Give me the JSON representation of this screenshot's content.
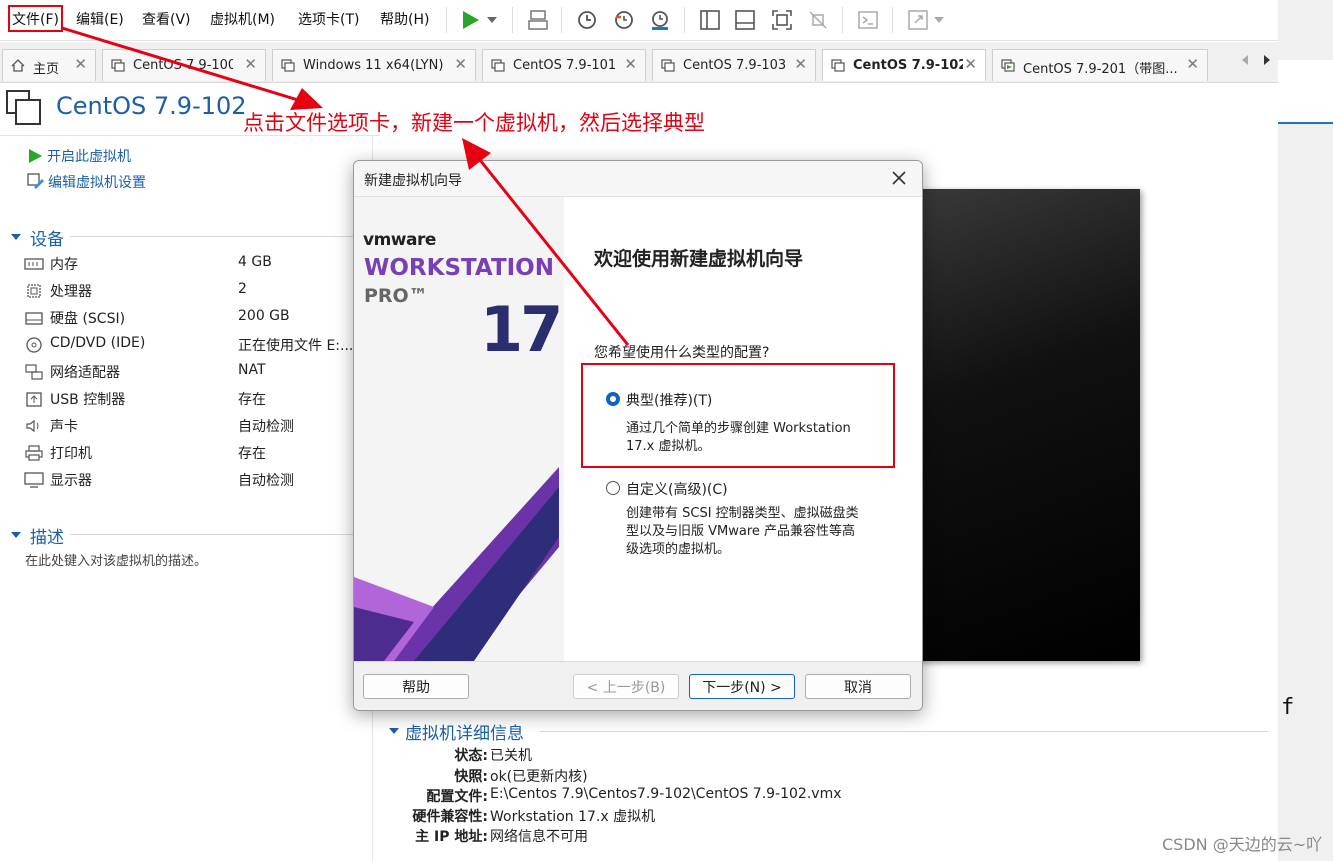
{
  "menubar": {
    "items": [
      "文件(F)",
      "编辑(E)",
      "查看(V)",
      "虚拟机(M)",
      "选项卡(T)",
      "帮助(H)"
    ]
  },
  "tabs": [
    {
      "label": "主页"
    },
    {
      "label": "CentOS 7.9-100"
    },
    {
      "label": "Windows 11 x64(LYN)"
    },
    {
      "label": "CentOS 7.9-101"
    },
    {
      "label": "CentOS 7.9-103"
    },
    {
      "label": "CentOS 7.9-102"
    },
    {
      "label": "CentOS 7.9-201（带图..."
    }
  ],
  "vm": {
    "title": "CentOS 7.9-102",
    "actions": {
      "power_on": "开启此虚拟机",
      "edit_settings": "编辑虚拟机设置"
    }
  },
  "devices": {
    "heading": "设备",
    "items": [
      {
        "name": "内存",
        "value": "4 GB",
        "icon": "memory-icon"
      },
      {
        "name": "处理器",
        "value": "2",
        "icon": "cpu-icon"
      },
      {
        "name": "硬盘 (SCSI)",
        "value": "200 GB",
        "icon": "disk-icon"
      },
      {
        "name": "CD/DVD (IDE)",
        "value": "正在使用文件 E:...",
        "icon": "cd-icon"
      },
      {
        "name": "网络适配器",
        "value": "NAT",
        "icon": "network-icon"
      },
      {
        "name": "USB 控制器",
        "value": "存在",
        "icon": "usb-icon"
      },
      {
        "name": "声卡",
        "value": "自动检测",
        "icon": "sound-icon"
      },
      {
        "name": "打印机",
        "value": "存在",
        "icon": "printer-icon"
      },
      {
        "name": "显示器",
        "value": "自动检测",
        "icon": "display-icon"
      }
    ]
  },
  "description": {
    "heading": "描述",
    "placeholder": "在此处键入对该虚拟机的描述。"
  },
  "details": {
    "heading": "虚拟机详细信息",
    "rows": [
      {
        "key": "状态:",
        "value": "已关机"
      },
      {
        "key": "快照:",
        "value": "ok(已更新内核)"
      },
      {
        "key": "配置文件:",
        "value": "E:\\Centos 7.9\\Centos7.9-102\\CentOS 7.9-102.vmx"
      },
      {
        "key": "硬件兼容性:",
        "value": "Workstation 17.x 虚拟机"
      },
      {
        "key": "主 IP 地址:",
        "value": "网络信息不可用"
      }
    ]
  },
  "dialog": {
    "title": "新建虚拟机向导",
    "brand": {
      "vendor": "vmware",
      "product": "WORKSTATION",
      "edition": "PRO™",
      "version": "17"
    },
    "heading": "欢迎使用新建虚拟机向导",
    "question": "您希望使用什么类型的配置?",
    "options": [
      {
        "label": "典型(推荐)(T)",
        "desc1": "通过几个简单的步骤创建 Workstation",
        "desc2": "17.x 虚拟机。",
        "selected": true
      },
      {
        "label": "自定义(高级)(C)",
        "desc1": "创建带有 SCSI 控制器类型、虚拟磁盘类",
        "desc2": "型以及与旧版 VMware 产品兼容性等高",
        "desc3": "级选项的虚拟机。",
        "selected": false
      }
    ],
    "buttons": {
      "help": "帮助",
      "back": "< 上一步(B)",
      "next": "下一步(N) >",
      "cancel": "取消"
    }
  },
  "annotation": {
    "text": "点击文件选项卡，新建一个虚拟机，然后选择典型",
    "color": "#e60012"
  },
  "watermark": "CSDN @天边的云~吖",
  "edge_text": "f",
  "colors": {
    "accent": "#1b5fa8",
    "brand_purple": "#7b3fb5",
    "run_green": "#2aa52a"
  }
}
